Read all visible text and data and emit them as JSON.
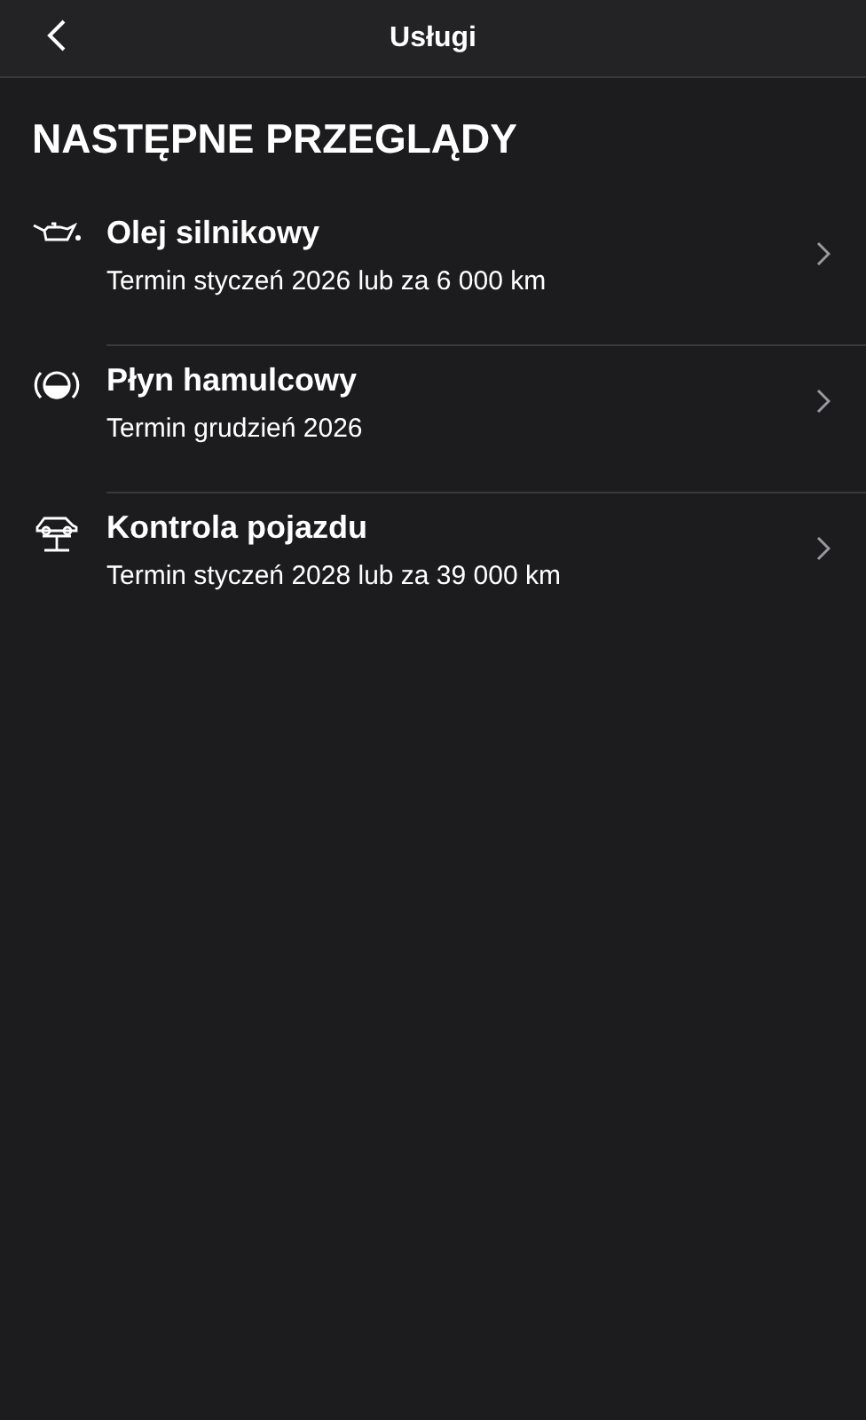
{
  "header": {
    "title": "Usługi"
  },
  "section_title": "NASTĘPNE PRZEGLĄDY",
  "services": [
    {
      "kind": "oil",
      "name": "Olej silnikowy",
      "due": "Termin styczeń 2026 lub za 6 000 km"
    },
    {
      "kind": "brake",
      "name": "Płyn hamulcowy",
      "due": "Termin grudzień 2026"
    },
    {
      "kind": "lift",
      "name": "Kontrola pojazdu",
      "due": "Termin styczeń 2028 lub za 39 000 km"
    }
  ]
}
